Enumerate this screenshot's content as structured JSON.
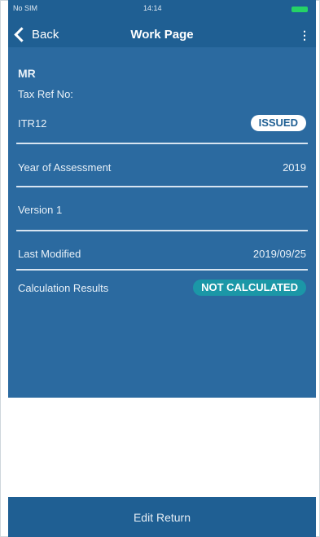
{
  "status_bar": {
    "carrier": "No SIM",
    "time": "14:14"
  },
  "nav": {
    "back_label": "Back",
    "title": "Work Page",
    "more": "⋮"
  },
  "taxpayer": {
    "name": "MR",
    "tax_ref_label": "Tax Ref No:"
  },
  "return": {
    "type": "ITR12",
    "status": "ISSUED"
  },
  "rows": {
    "year_label": "Year of Assessment",
    "year_value": "2019",
    "version_label": "Version 1",
    "modified_label": "Last Modified",
    "modified_value": "2019/09/25",
    "calc_label": "Calculation Results",
    "calc_status": "NOT CALCULATED"
  },
  "footer": {
    "edit_label": "Edit Return"
  },
  "colors": {
    "primary": "#1f5f93",
    "card": "#2b6aa0",
    "teal": "#1b97a7"
  }
}
